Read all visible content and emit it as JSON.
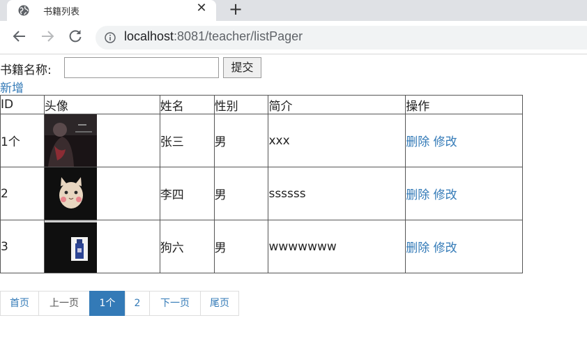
{
  "browser": {
    "tab_title": "书籍列表",
    "close_glyph": "✕",
    "new_tab_glyph": "+",
    "url_host": "localhost",
    "url_path": ":8081/teacher/listPager"
  },
  "search": {
    "label": "书籍名称:",
    "value": "",
    "submit_label": "提交"
  },
  "add_link": "新增",
  "table": {
    "headers": [
      "ID",
      "头像",
      "姓名",
      "性别",
      "简介",
      "操作"
    ],
    "rows": [
      {
        "id": "1个",
        "name": "张三",
        "gender": "男",
        "intro": "xxx",
        "avatar_icon": "dark-portrait-avatar",
        "delete": "删除",
        "edit": "修改"
      },
      {
        "id": "2",
        "name": "李四",
        "gender": "男",
        "intro": "ssssss",
        "avatar_icon": "cat-avatar",
        "delete": "删除",
        "edit": "修改"
      },
      {
        "id": "3",
        "name": "狗六",
        "gender": "男",
        "intro": "wwwwwww",
        "avatar_icon": "bottle-avatar",
        "delete": "删除",
        "edit": "修改"
      }
    ]
  },
  "pagination": {
    "first": "首页",
    "prev": "上一页",
    "pages": [
      "1个",
      "2"
    ],
    "current": "1个",
    "next": "下一页",
    "last": "尾页"
  },
  "colors": {
    "link": "#337ab7",
    "active_page_bg": "#337ab7",
    "tab_strip": "#dfe1e5"
  }
}
